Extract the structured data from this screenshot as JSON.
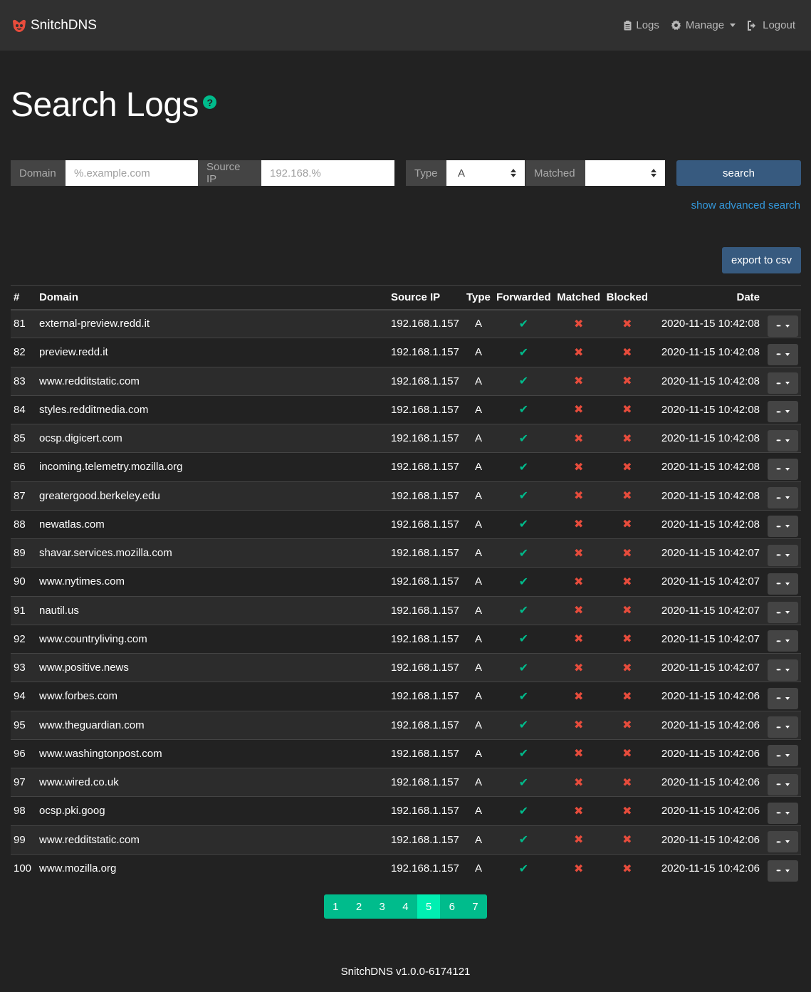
{
  "nav": {
    "brand": "SnitchDNS",
    "logs": "Logs",
    "manage": "Manage",
    "logout": "Logout"
  },
  "page": {
    "title": "Search Logs"
  },
  "search": {
    "domain_label": "Domain",
    "domain_placeholder": "%.example.com",
    "source_ip_label": "Source IP",
    "source_ip_placeholder": "192.168.%",
    "type_label": "Type",
    "type_value": "A",
    "matched_label": "Matched",
    "matched_value": "",
    "search_button": "search",
    "advanced_link": "show advanced search"
  },
  "export_button": "export to csv",
  "table": {
    "headers": [
      "#",
      "Domain",
      "Source IP",
      "Type",
      "Forwarded",
      "Matched",
      "Blocked",
      "Date"
    ],
    "rows": [
      {
        "num": "81",
        "domain": "external-preview.redd.it",
        "ip": "192.168.1.157",
        "type": "A",
        "forwarded": true,
        "matched": false,
        "blocked": false,
        "date": "2020-11-15 10:42:08"
      },
      {
        "num": "82",
        "domain": "preview.redd.it",
        "ip": "192.168.1.157",
        "type": "A",
        "forwarded": true,
        "matched": false,
        "blocked": false,
        "date": "2020-11-15 10:42:08"
      },
      {
        "num": "83",
        "domain": "www.redditstatic.com",
        "ip": "192.168.1.157",
        "type": "A",
        "forwarded": true,
        "matched": false,
        "blocked": false,
        "date": "2020-11-15 10:42:08"
      },
      {
        "num": "84",
        "domain": "styles.redditmedia.com",
        "ip": "192.168.1.157",
        "type": "A",
        "forwarded": true,
        "matched": false,
        "blocked": false,
        "date": "2020-11-15 10:42:08"
      },
      {
        "num": "85",
        "domain": "ocsp.digicert.com",
        "ip": "192.168.1.157",
        "type": "A",
        "forwarded": true,
        "matched": false,
        "blocked": false,
        "date": "2020-11-15 10:42:08"
      },
      {
        "num": "86",
        "domain": "incoming.telemetry.mozilla.org",
        "ip": "192.168.1.157",
        "type": "A",
        "forwarded": true,
        "matched": false,
        "blocked": false,
        "date": "2020-11-15 10:42:08"
      },
      {
        "num": "87",
        "domain": "greatergood.berkeley.edu",
        "ip": "192.168.1.157",
        "type": "A",
        "forwarded": true,
        "matched": false,
        "blocked": false,
        "date": "2020-11-15 10:42:08"
      },
      {
        "num": "88",
        "domain": "newatlas.com",
        "ip": "192.168.1.157",
        "type": "A",
        "forwarded": true,
        "matched": false,
        "blocked": false,
        "date": "2020-11-15 10:42:08"
      },
      {
        "num": "89",
        "domain": "shavar.services.mozilla.com",
        "ip": "192.168.1.157",
        "type": "A",
        "forwarded": true,
        "matched": false,
        "blocked": false,
        "date": "2020-11-15 10:42:07"
      },
      {
        "num": "90",
        "domain": "www.nytimes.com",
        "ip": "192.168.1.157",
        "type": "A",
        "forwarded": true,
        "matched": false,
        "blocked": false,
        "date": "2020-11-15 10:42:07"
      },
      {
        "num": "91",
        "domain": "nautil.us",
        "ip": "192.168.1.157",
        "type": "A",
        "forwarded": true,
        "matched": false,
        "blocked": false,
        "date": "2020-11-15 10:42:07"
      },
      {
        "num": "92",
        "domain": "www.countryliving.com",
        "ip": "192.168.1.157",
        "type": "A",
        "forwarded": true,
        "matched": false,
        "blocked": false,
        "date": "2020-11-15 10:42:07"
      },
      {
        "num": "93",
        "domain": "www.positive.news",
        "ip": "192.168.1.157",
        "type": "A",
        "forwarded": true,
        "matched": false,
        "blocked": false,
        "date": "2020-11-15 10:42:07"
      },
      {
        "num": "94",
        "domain": "www.forbes.com",
        "ip": "192.168.1.157",
        "type": "A",
        "forwarded": true,
        "matched": false,
        "blocked": false,
        "date": "2020-11-15 10:42:06"
      },
      {
        "num": "95",
        "domain": "www.theguardian.com",
        "ip": "192.168.1.157",
        "type": "A",
        "forwarded": true,
        "matched": false,
        "blocked": false,
        "date": "2020-11-15 10:42:06"
      },
      {
        "num": "96",
        "domain": "www.washingtonpost.com",
        "ip": "192.168.1.157",
        "type": "A",
        "forwarded": true,
        "matched": false,
        "blocked": false,
        "date": "2020-11-15 10:42:06"
      },
      {
        "num": "97",
        "domain": "www.wired.co.uk",
        "ip": "192.168.1.157",
        "type": "A",
        "forwarded": true,
        "matched": false,
        "blocked": false,
        "date": "2020-11-15 10:42:06"
      },
      {
        "num": "98",
        "domain": "ocsp.pki.goog",
        "ip": "192.168.1.157",
        "type": "A",
        "forwarded": true,
        "matched": false,
        "blocked": false,
        "date": "2020-11-15 10:42:06"
      },
      {
        "num": "99",
        "domain": "www.redditstatic.com",
        "ip": "192.168.1.157",
        "type": "A",
        "forwarded": true,
        "matched": false,
        "blocked": false,
        "date": "2020-11-15 10:42:06"
      },
      {
        "num": "100",
        "domain": "www.mozilla.org",
        "ip": "192.168.1.157",
        "type": "A",
        "forwarded": true,
        "matched": false,
        "blocked": false,
        "date": "2020-11-15 10:42:06"
      }
    ]
  },
  "pagination": {
    "pages": [
      "1",
      "2",
      "3",
      "4",
      "5",
      "6",
      "7"
    ],
    "active": "5"
  },
  "footer": "SnitchDNS v1.0.0-6174121",
  "colors": {
    "accent": "#00bc8c",
    "danger": "#e74c3c",
    "primary": "#375a7f",
    "link": "#3498db"
  }
}
